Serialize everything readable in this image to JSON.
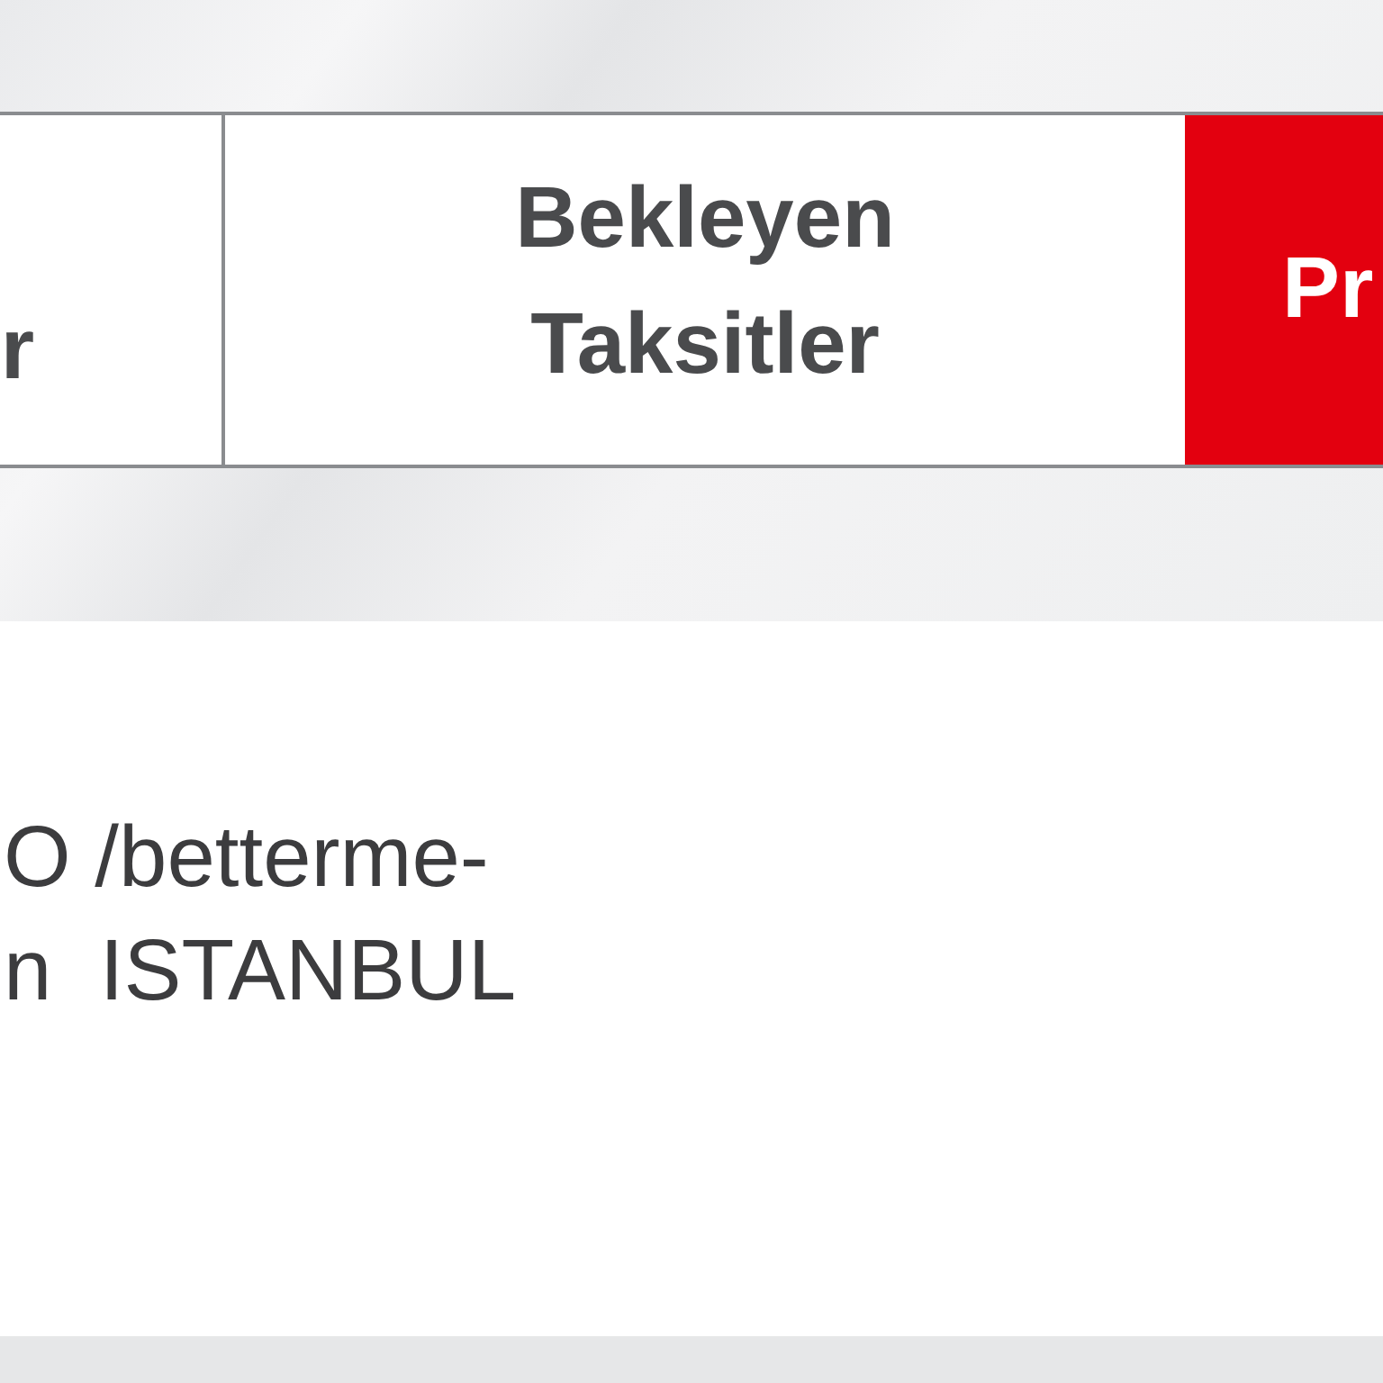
{
  "tabs": [
    {
      "label": "r",
      "selected": false
    },
    {
      "label": "Bekleyen Taksitler",
      "selected": false
    },
    {
      "label": "Pr",
      "selected": true
    }
  ],
  "address": {
    "lines": [
      "O /betterme-",
      "n  ISTANBUL"
    ]
  }
}
